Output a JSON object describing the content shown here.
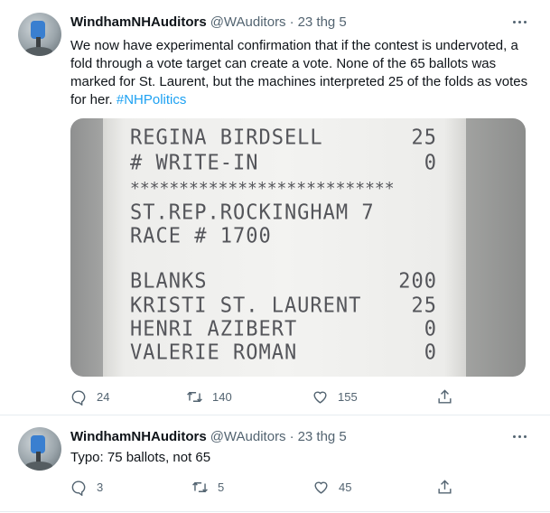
{
  "tweets": [
    {
      "display_name": "WindhamNHAuditors",
      "handle": "@WAuditors",
      "separator": "·",
      "date": "23 thg 5",
      "text_main": "We now have experimental confirmation that if the contest is undervoted, a fold through a vote target can create a vote. None of the 65 ballots was marked for St. Laurent, but the machines interpreted 25 of the folds as votes for her. ",
      "hashtag": "#NHPolitics",
      "photo": {
        "lines": [
          {
            "label": "REGINA BIRDSELL",
            "value": "25"
          },
          {
            "label": "# WRITE-IN",
            "value": "0"
          },
          {
            "label": "***************************",
            "value": ""
          },
          {
            "label": "ST.REP.ROCKINGHAM 7",
            "value": ""
          },
          {
            "label": "RACE # 1700",
            "value": ""
          },
          {
            "label": "BLANKS",
            "value": "200"
          },
          {
            "label": "KRISTI ST. LAURENT",
            "value": "25"
          },
          {
            "label": "HENRI AZIBERT",
            "value": "0"
          },
          {
            "label": "VALERIE ROMAN",
            "value": "0"
          }
        ]
      },
      "replies": "24",
      "retweets": "140",
      "likes": "155"
    },
    {
      "display_name": "WindhamNHAuditors",
      "handle": "@WAuditors",
      "separator": "·",
      "date": "23 thg 5",
      "text_main": "Typo: 75 ballots, not 65",
      "replies": "3",
      "retweets": "5",
      "likes": "45"
    }
  ],
  "colors": {
    "accent": "#1da1f2",
    "text": "#0f1419",
    "muted": "#536471",
    "divider": "#e6ecf0"
  },
  "icons": [
    "reply-icon",
    "retweet-icon",
    "like-icon",
    "share-icon",
    "more-icon"
  ]
}
